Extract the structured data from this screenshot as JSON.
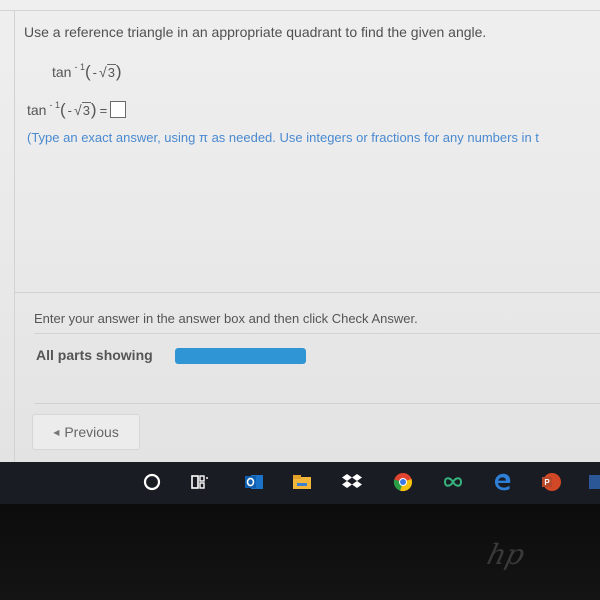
{
  "question": {
    "instruction": "Use a reference triangle in an appropriate quadrant to find the given angle.",
    "expression": {
      "function": "tan",
      "exponent": "- 1",
      "sign": "-",
      "radicand": "3"
    },
    "answer_prompt": {
      "function": "tan",
      "exponent": "- 1",
      "sign": "-",
      "radicand": "3",
      "equals": "=",
      "answer_value": ""
    },
    "hint": "(Type an exact answer, using π as needed. Use integers or fractions for any numbers in t"
  },
  "status": {
    "enter_message": "Enter your answer in the answer box and then click Check Answer.",
    "parts_label": "All parts showing",
    "progress_fraction": 1.0
  },
  "navigation": {
    "previous_label": "Previous"
  },
  "taskbar": {
    "icons": [
      "cortana-icon",
      "task-view-icon",
      "outlook-icon",
      "file-explorer-icon",
      "dropbox-icon",
      "chrome-icon",
      "infinity-app-icon",
      "edge-icon",
      "powerpoint-icon",
      "word-icon"
    ]
  },
  "colors": {
    "hint_blue": "#4a8ad0",
    "progress_blue": "#2f95d4",
    "taskbar": "#191c22"
  }
}
